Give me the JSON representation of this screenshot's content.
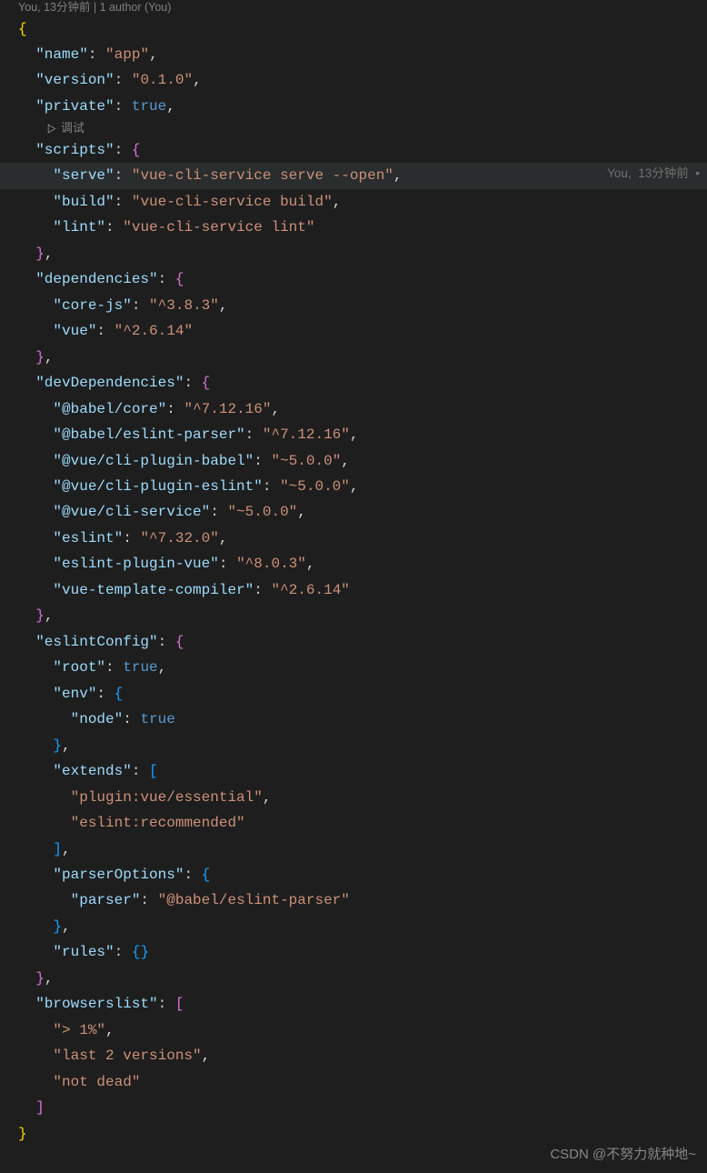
{
  "codelens_top": "You, 13分钟前 | 1 author (You)",
  "debug_label": "调试",
  "blame": {
    "author": "You,",
    "time": "13分钟前"
  },
  "watermark": "CSDN @不努力就种地~",
  "json": {
    "name": "app",
    "version": "0.1.0",
    "private": true,
    "scripts": {
      "serve": "vue-cli-service serve --open",
      "build": "vue-cli-service build",
      "lint": "vue-cli-service lint"
    },
    "dependencies": {
      "core-js": "^3.8.3",
      "vue": "^2.6.14"
    },
    "devDependencies": {
      "@babel/core": "^7.12.16",
      "@babel/eslint-parser": "^7.12.16",
      "@vue/cli-plugin-babel": "~5.0.0",
      "@vue/cli-plugin-eslint": "~5.0.0",
      "@vue/cli-service": "~5.0.0",
      "eslint": "^7.32.0",
      "eslint-plugin-vue": "^8.0.3",
      "vue-template-compiler": "^2.6.14"
    },
    "eslintConfig": {
      "root": true,
      "env": {
        "node": true
      },
      "extends": [
        "plugin:vue/essential",
        "eslint:recommended"
      ],
      "parserOptions": {
        "parser": "@babel/eslint-parser"
      },
      "rules": {}
    },
    "browserslist": [
      "> 1%",
      "last 2 versions",
      "not dead"
    ]
  }
}
